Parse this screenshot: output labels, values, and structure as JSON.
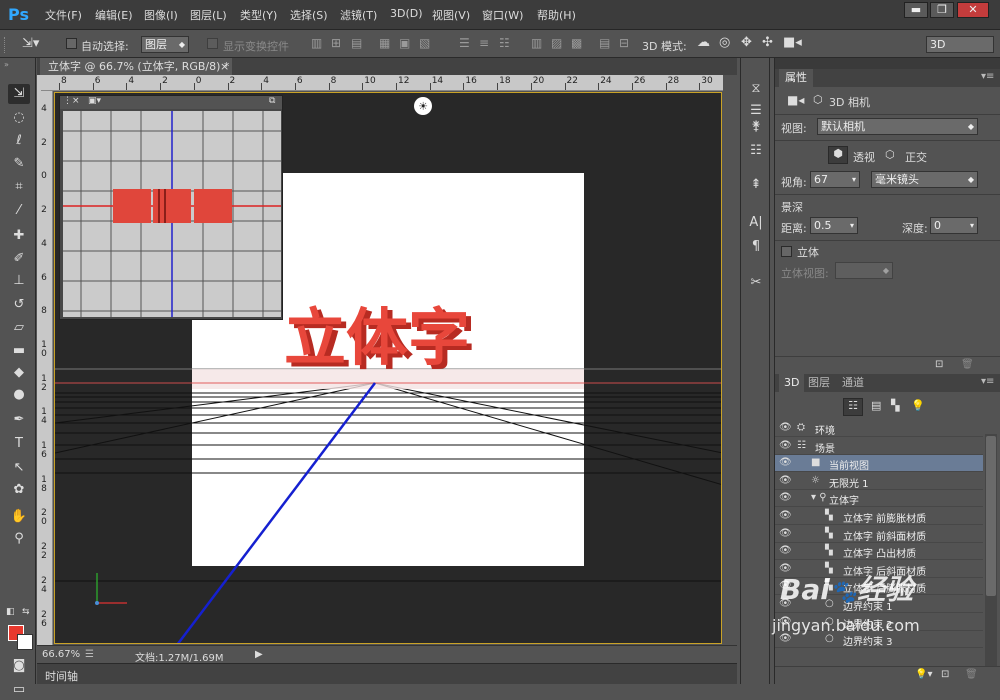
{
  "app": {
    "logo": "Ps",
    "menus": [
      "文件(F)",
      "编辑(E)",
      "图像(I)",
      "图层(L)",
      "类型(Y)",
      "选择(S)",
      "滤镜(T)",
      "3D(D)",
      "视图(V)",
      "窗口(W)",
      "帮助(H)"
    ],
    "window_buttons": [
      "▬",
      "❐",
      "✕"
    ]
  },
  "options_bar": {
    "auto_select_label": "自动选择:",
    "auto_select_value": "图层",
    "show_transform_label": "显示变换控件",
    "mode_3d_label": "3D 模式:",
    "workspace_value": "3D"
  },
  "document": {
    "tab_title": "立体字 @ 66.7% (立体字, RGB/8) *",
    "close_glyph": "×",
    "ruler_h_labels": [
      "8",
      "6",
      "4",
      "2",
      "0",
      "2",
      "4",
      "6",
      "8",
      "10",
      "12",
      "14",
      "16",
      "18",
      "20",
      "22",
      "24",
      "26",
      "28",
      "30"
    ],
    "ruler_v_labels": [
      "4",
      "2",
      "0",
      "2",
      "4",
      "6",
      "8",
      "1\n0",
      "1\n2",
      "1\n4",
      "1\n6",
      "1\n8",
      "2\n0",
      "2\n2",
      "2\n4",
      "2\n6"
    ],
    "canvas_text": "立体字",
    "zoom": "66.67%",
    "doc_size": "文档:1.27M/1.69M"
  },
  "timeline": {
    "label": "时间轴"
  },
  "properties": {
    "tab": "属性",
    "title": "3D 相机",
    "view_label": "视图:",
    "view_value": "默认相机",
    "perspective_label": "透视",
    "ortho_label": "正交",
    "fov_label": "视角:",
    "fov_value": "67",
    "lens_value": "毫米镜头",
    "dof_label": "景深",
    "distance_label": "距离:",
    "distance_value": "0.5",
    "depth_label": "深度:",
    "depth_value": "0",
    "stereo_label": "立体",
    "stereo_view_label": "立体视图:"
  },
  "layers_panel": {
    "tabs": [
      "3D",
      "图层",
      "通道"
    ],
    "rows": [
      {
        "label": "环境",
        "indent": 0,
        "icon": "⛭",
        "selected": false
      },
      {
        "label": "场景",
        "indent": 0,
        "icon": "☷",
        "selected": false
      },
      {
        "label": "当前视图",
        "indent": 1,
        "icon": "■",
        "selected": true
      },
      {
        "label": "无限光 1",
        "indent": 1,
        "icon": "☼",
        "selected": false
      },
      {
        "label": "立体字",
        "indent": 1,
        "icon": "▾ ⚲",
        "selected": false
      },
      {
        "label": "立体字 前膨胀材质",
        "indent": 2,
        "icon": "▚",
        "selected": false
      },
      {
        "label": "立体字 前斜面材质",
        "indent": 2,
        "icon": "▚",
        "selected": false
      },
      {
        "label": "立体字 凸出材质",
        "indent": 2,
        "icon": "▚",
        "selected": false
      },
      {
        "label": "立体字 后斜面材质",
        "indent": 2,
        "icon": "▚",
        "selected": false
      },
      {
        "label": "立体字 后膨胀材质",
        "indent": 2,
        "icon": "▚",
        "selected": false
      },
      {
        "label": "边界约束 1",
        "indent": 2,
        "icon": "○",
        "selected": false
      },
      {
        "label": "边界约束 2",
        "indent": 2,
        "icon": "○",
        "selected": false
      },
      {
        "label": "边界约束 3",
        "indent": 2,
        "icon": "○",
        "selected": false
      },
      {
        "label": "边界约束 4",
        "indent": 2,
        "icon": "○",
        "selected": false
      }
    ]
  },
  "watermark": {
    "brand": "Bai",
    "brand2": "经验",
    "url": "jingyan.baidu.com"
  },
  "colors": {
    "accent_text": "#e8392e",
    "selection": "#6a7c96",
    "canvas_border": "#c9a227"
  }
}
